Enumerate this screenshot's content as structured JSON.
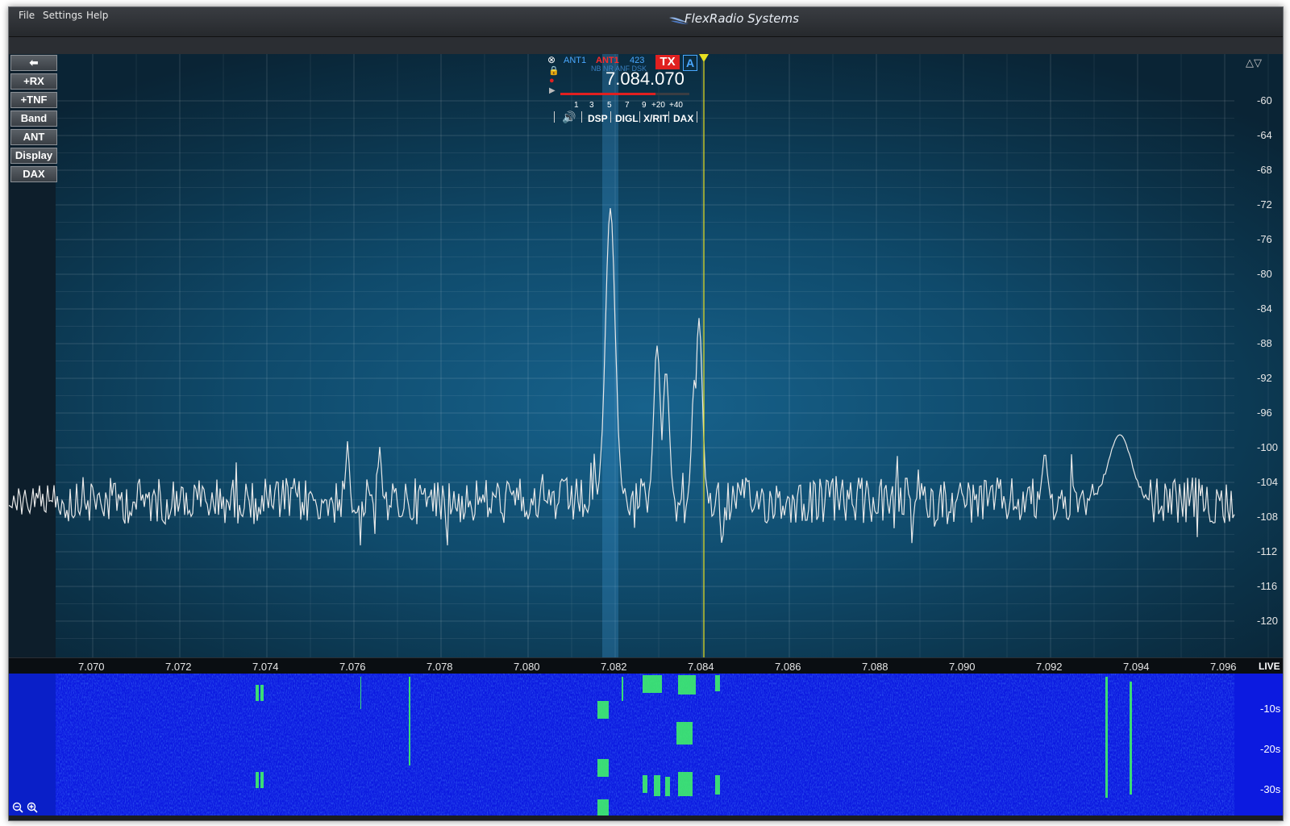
{
  "menu": {
    "file": "File",
    "settings": "Settings",
    "help": "Help"
  },
  "brand": {
    "title": "FlexRadio Systems"
  },
  "side_buttons": {
    "back": "",
    "rx": "+RX",
    "tnf": "+TNF",
    "band": "Band",
    "ant": "ANT",
    "display": "Display",
    "dax": "DAX"
  },
  "slice": {
    "rx_ant": "ANT1",
    "tx_ant": "ANT1",
    "filter": "423",
    "dsp_flags": "NB NR ANF DSK",
    "tx": "TX",
    "letter": "A",
    "frequency": "7.084.070",
    "meter_scale": [
      "1",
      "3",
      "5",
      "7",
      "9",
      "+20",
      "+40"
    ],
    "dsp": "DSP",
    "mode": "DIGL",
    "xrit": "X/RIT",
    "dax": "DAX"
  },
  "dbm_scale": [
    "-60",
    "-64",
    "-68",
    "-72",
    "-76",
    "-80",
    "-84",
    "-88",
    "-92",
    "-96",
    "-100",
    "-104",
    "-108",
    "-112",
    "-116",
    "-120"
  ],
  "freq_scale": [
    "7.070",
    "7.072",
    "7.074",
    "7.076",
    "7.078",
    "7.080",
    "7.082",
    "7.084",
    "7.086",
    "7.088",
    "7.090",
    "7.092",
    "7.094",
    "7.096"
  ],
  "live": "LIVE",
  "waterfall_time": [
    "-10s",
    "-20s",
    "-30s"
  ],
  "colors": {
    "pan_center": "#17628c",
    "waterfall": "#0c1ae0",
    "signal": "#3ff06a",
    "trace": "#e8e8e8",
    "cursor": "#e8e020",
    "tx_red": "#e02020"
  }
}
